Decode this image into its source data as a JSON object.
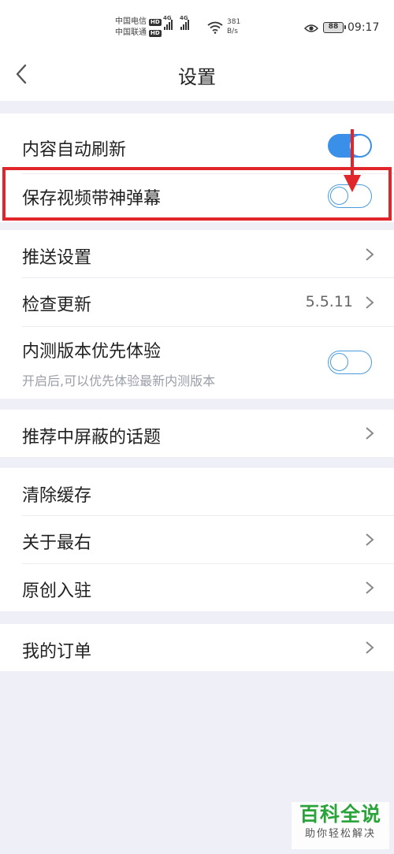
{
  "status_bar": {
    "carrier_1": "中国电信",
    "carrier_2": "中国联通",
    "hd": "HD",
    "network_tag": "4G",
    "speed_value": "381",
    "speed_unit": "B/s",
    "battery": "88",
    "time": "09:17"
  },
  "header": {
    "title": "设置"
  },
  "settings": {
    "auto_refresh": {
      "label": "内容自动刷新",
      "enabled": true
    },
    "save_danmaku": {
      "label": "保存视频带神弹幕",
      "enabled": false
    },
    "push": {
      "label": "推送设置"
    },
    "check_update": {
      "label": "检查更新",
      "value": "5.5.11"
    },
    "beta": {
      "label": "内测版本优先体验",
      "description": "开启后,可以优先体验最新内测版本",
      "enabled": false
    },
    "blocked_topics": {
      "label": "推荐中屏蔽的话题"
    },
    "clear_cache": {
      "label": "清除缓存"
    },
    "about": {
      "label": "关于最右"
    },
    "original": {
      "label": "原创入驻"
    },
    "orders": {
      "label": "我的订单"
    }
  },
  "colors": {
    "accent": "#3a8fe8",
    "highlight": "#e0262a",
    "background": "#eff0f7"
  },
  "watermark": {
    "title": "百科全说",
    "subtitle": "助你轻松解决"
  }
}
